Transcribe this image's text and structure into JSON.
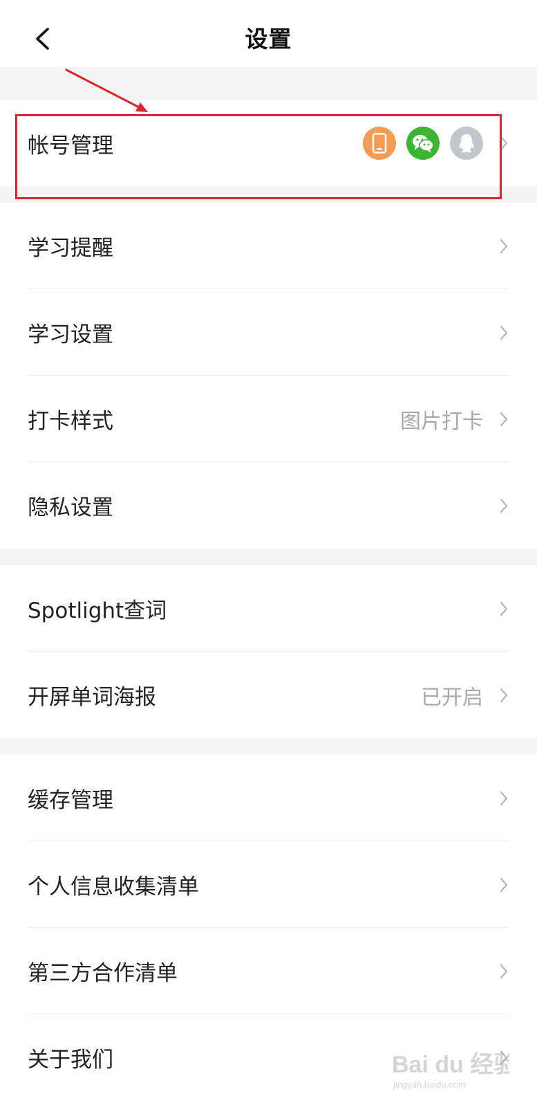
{
  "header": {
    "title": "设置",
    "back_icon": "chevron-left-icon"
  },
  "account": {
    "label": "帐号管理",
    "bound_icons": [
      "phone-icon",
      "wechat-icon",
      "qq-icon"
    ],
    "colors": {
      "phone": "#f19b55",
      "wechat": "#3cb531",
      "qq": "#c3c7cd"
    }
  },
  "groups": [
    {
      "items": [
        {
          "label": "学习提醒",
          "value": ""
        },
        {
          "label": "学习设置",
          "value": ""
        },
        {
          "label": "打卡样式",
          "value": "图片打卡"
        },
        {
          "label": "隐私设置",
          "value": ""
        }
      ]
    },
    {
      "items": [
        {
          "label": "Spotlight查词",
          "value": ""
        },
        {
          "label": "开屏单词海报",
          "value": "已开启"
        }
      ]
    },
    {
      "items": [
        {
          "label": "缓存管理",
          "value": ""
        },
        {
          "label": "个人信息收集清单",
          "value": ""
        },
        {
          "label": "第三方合作清单",
          "value": ""
        },
        {
          "label": "关于我们",
          "value": ""
        }
      ]
    }
  ],
  "annotation_color": "#d9262c",
  "watermark": {
    "text": "Bai du 经验",
    "url_text": "jingyan.baidu.com"
  }
}
